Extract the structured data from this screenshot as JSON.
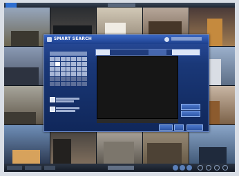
{
  "window": {
    "title": "SMART SEARCH"
  },
  "colors": {
    "dialog_bg": "#1a3878",
    "title_bar": "#2b58b0",
    "accent": "#2f6fd1"
  },
  "camera_grid": {
    "columns": 5,
    "rows": 4
  },
  "icons": [
    "camera-icon",
    "clock-icon",
    "close-icon",
    "calendar-icon",
    "play-icon"
  ]
}
